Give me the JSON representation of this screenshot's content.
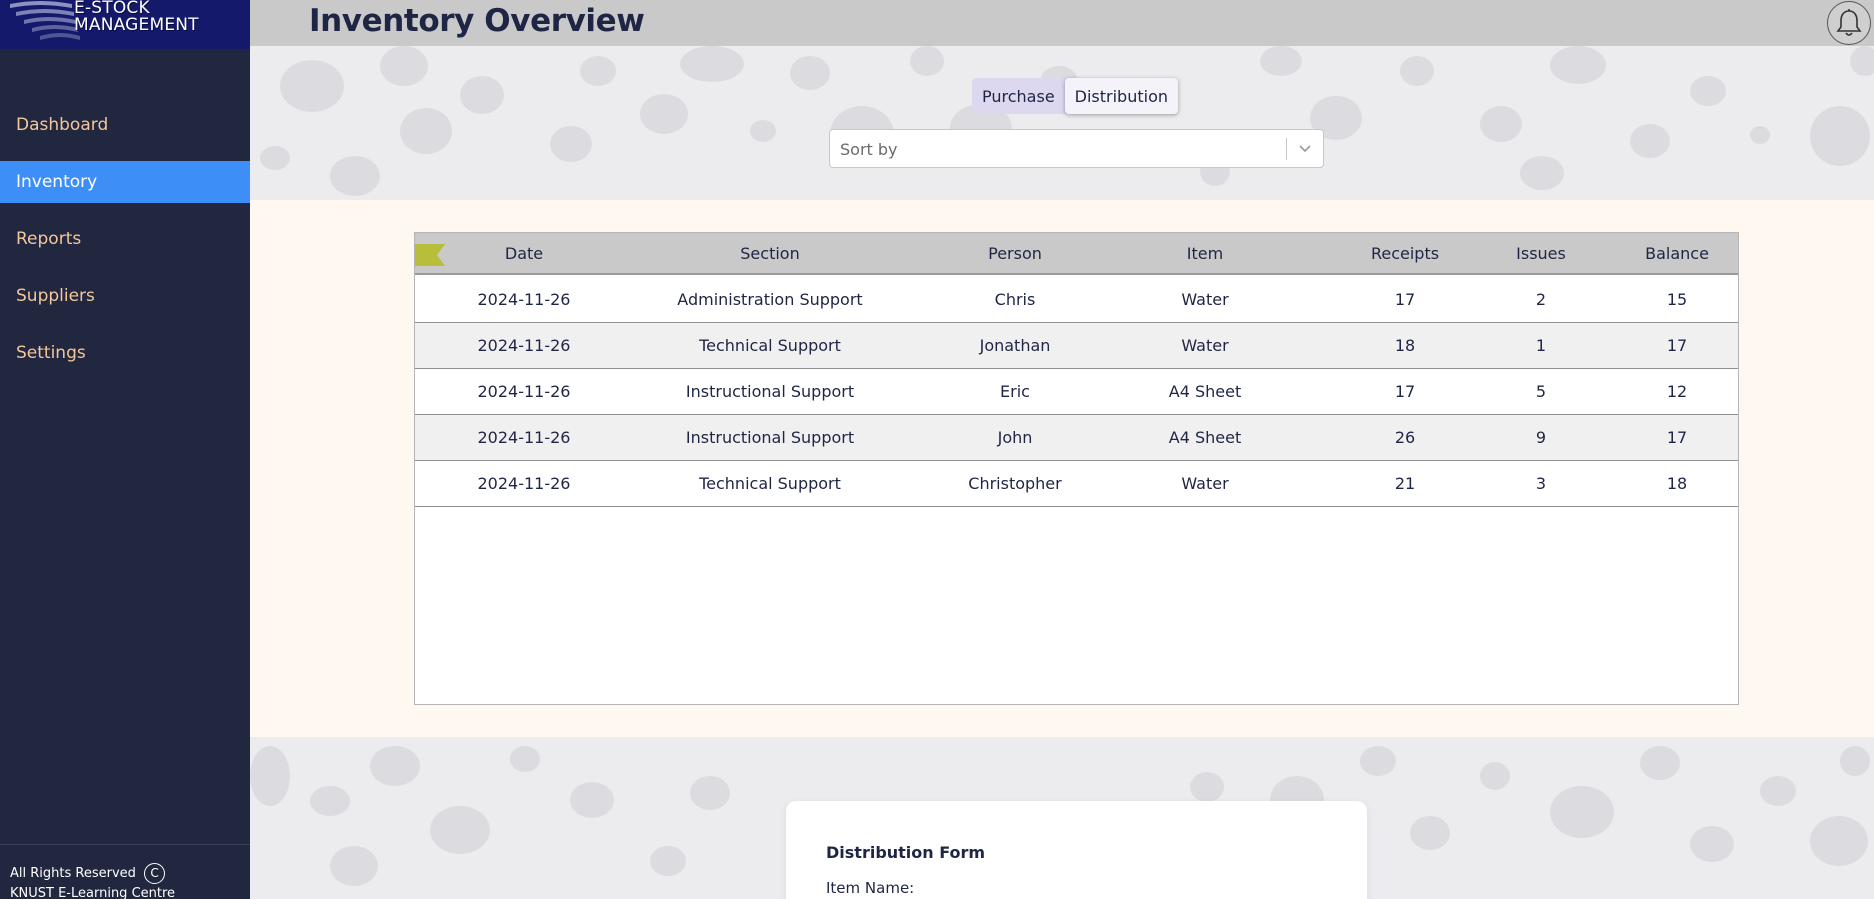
{
  "app": {
    "logo_line1": "E-STOCK",
    "logo_line2": "MANAGEMENT",
    "page_title": "Inventory Overview"
  },
  "sidebar": {
    "items": [
      {
        "label": "Dashboard",
        "active": false
      },
      {
        "label": "Inventory",
        "active": true
      },
      {
        "label": "Reports",
        "active": false
      },
      {
        "label": "Suppliers",
        "active": false
      },
      {
        "label": "Settings",
        "active": false
      }
    ],
    "footer_line1": "All Rights Reserved",
    "footer_symbol": "C",
    "footer_line2": "KNUST E-Learning Centre"
  },
  "header": {
    "bell_icon": "bell-icon"
  },
  "toggle": {
    "options": [
      "Purchase",
      "Distribution"
    ],
    "selected": "Distribution"
  },
  "sort": {
    "placeholder": "Sort by"
  },
  "table": {
    "columns": [
      "Date",
      "Section",
      "Person",
      "Item",
      "Receipts",
      "Issues",
      "Balance"
    ],
    "rows": [
      [
        "2024-11-26",
        "Administration Support",
        "Chris",
        "Water",
        "17",
        "2",
        "15"
      ],
      [
        "2024-11-26",
        "Technical Support",
        "Jonathan",
        "Water",
        "18",
        "1",
        "17"
      ],
      [
        "2024-11-26",
        "Instructional Support",
        "Eric",
        "A4 Sheet",
        "17",
        "5",
        "12"
      ],
      [
        "2024-11-26",
        "Instructional Support",
        "John",
        "A4 Sheet",
        "26",
        "9",
        "17"
      ],
      [
        "2024-11-26",
        "Technical Support",
        "Christopher",
        "Water",
        "21",
        "3",
        "18"
      ]
    ]
  },
  "form": {
    "title": "Distribution Form",
    "item_name_label": "Item Name:"
  },
  "colors": {
    "sidebar_bg": "#222740",
    "logo_bg": "#15196b",
    "nav_text": "#f3c79a",
    "nav_active": "#3e8ef7",
    "header_bg": "#c9c9c9",
    "band_bg": "#fff8f0",
    "flag": "#b8bd3a"
  }
}
